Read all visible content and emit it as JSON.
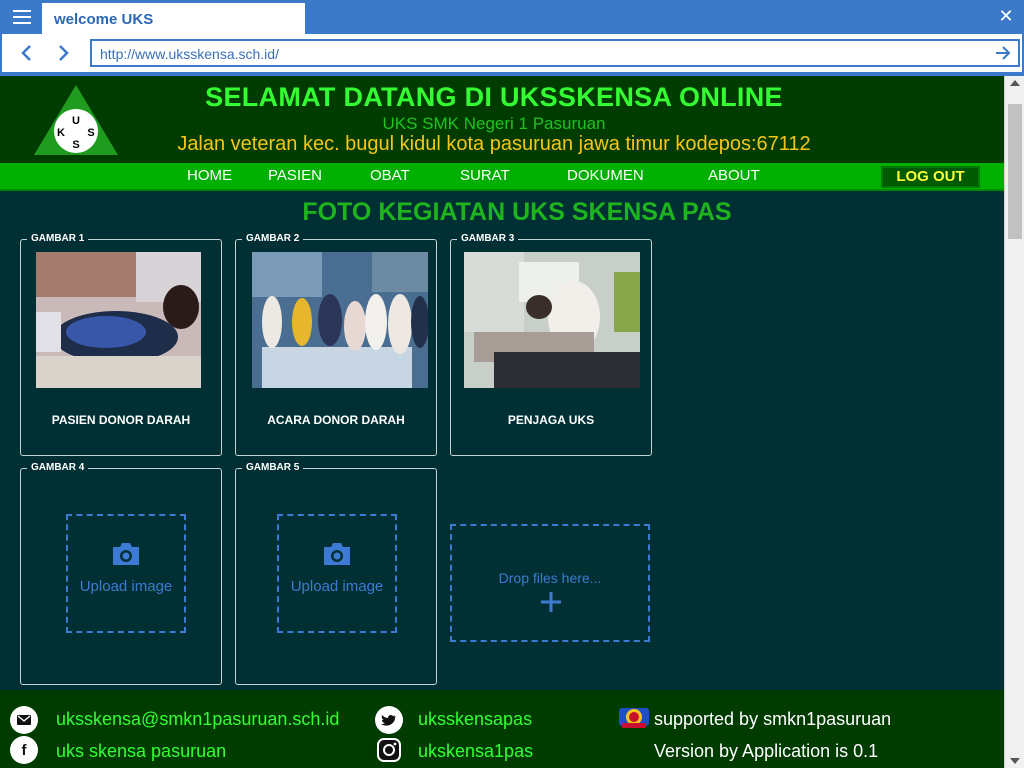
{
  "browser": {
    "tab_title": "welcome UKS",
    "url": "http://www.uksskensa.sch.id/"
  },
  "header": {
    "logo_letters": [
      "U",
      "K",
      "S",
      "S"
    ],
    "title": "SELAMAT DATANG DI UKSSKENSA ONLINE",
    "subtitle": "UKS SMK Negeri 1 Pasuruan",
    "address": "Jalan veteran kec. bugul kidul kota pasuruan jawa timur kodepos:67112"
  },
  "menu": {
    "items": [
      "HOME",
      "PASIEN",
      "OBAT",
      "SURAT",
      "DOKUMEN",
      "ABOUT"
    ],
    "logout": "LOG OUT"
  },
  "main": {
    "title": "FOTO KEGIATAN UKS SKENSA PAS",
    "gallery": [
      {
        "legend": "GAMBAR 1",
        "caption": "PASIEN DONOR DARAH"
      },
      {
        "legend": "GAMBAR 2",
        "caption": "ACARA DONOR DARAH"
      },
      {
        "legend": "GAMBAR 3",
        "caption": "PENJAGA UKS"
      },
      {
        "legend": "GAMBAR 4",
        "upload_label": "Upload image"
      },
      {
        "legend": "GAMBAR 5",
        "upload_label": "Upload image"
      }
    ],
    "drop_zone_label": "Drop files here..."
  },
  "footer": {
    "email": "uksskensa@smkn1pasuruan.sch.id",
    "facebook": "uks skensa pasuruan",
    "twitter": "uksskensapas",
    "instagram": "ukskensa1pas",
    "supported": "supported by smkn1pasuruan",
    "version": "Version by Application is 0.1"
  },
  "colors": {
    "page_bg": "#003033",
    "header_bg": "#003b00",
    "menu_bg": "#00b000",
    "title_green": "#33ff33",
    "address_yellow": "#f5c518",
    "accent_blue": "#3d7ad3"
  }
}
